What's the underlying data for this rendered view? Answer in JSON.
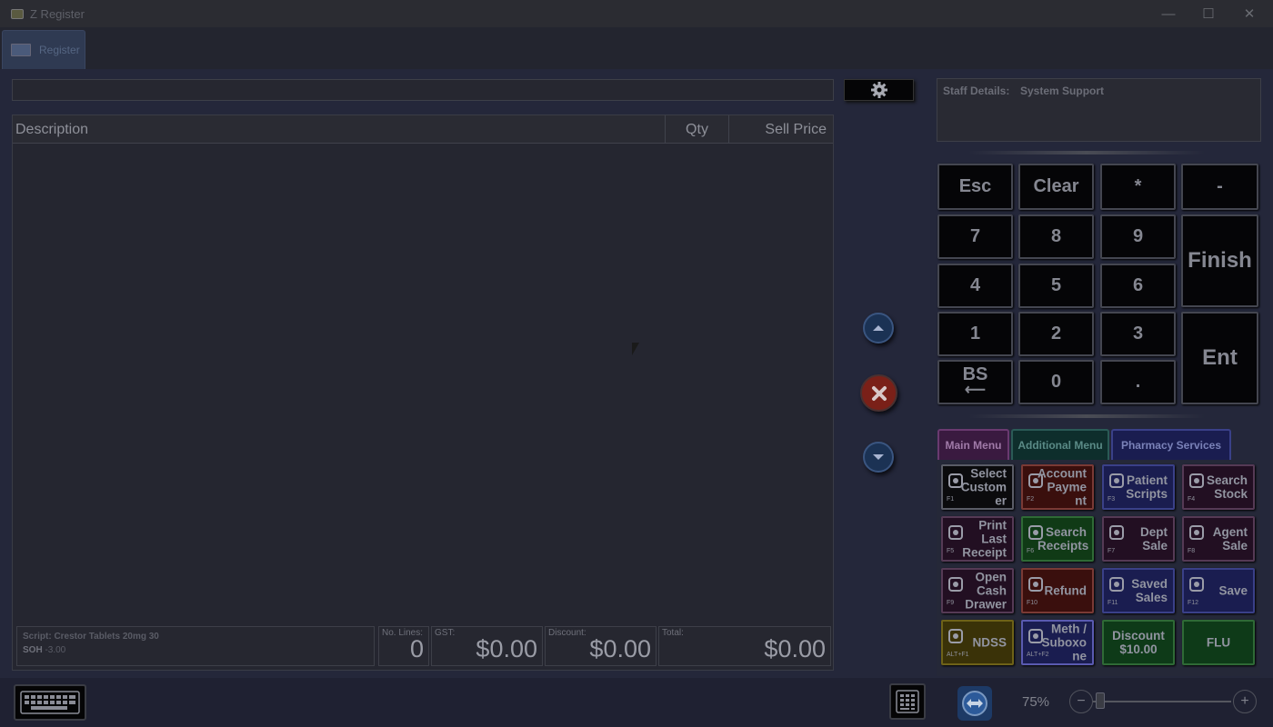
{
  "window": {
    "title": "Z Register",
    "minimize": "—",
    "maximize": "☐",
    "close": "✕"
  },
  "tabs": [
    {
      "label": "Register"
    }
  ],
  "grid": {
    "col_description": "Description",
    "col_qty": "Qty",
    "col_sell_price": "Sell Price",
    "rows": []
  },
  "footer": {
    "script": "Script: Crestor Tablets 20mg 30",
    "soh_label": "SOH",
    "soh_value": "-3.00",
    "no_lines_label": "No. Lines:",
    "no_lines_value": "0",
    "gst_label": "GST:",
    "gst_value": "$0.00",
    "discount_label": "Discount:",
    "discount_value": "$0.00",
    "total_label": "Total:",
    "total_value": "$0.00"
  },
  "staff": {
    "label": "Staff Details:",
    "value": "System Support"
  },
  "keypad": {
    "esc": "Esc",
    "clear": "Clear",
    "star": "*",
    "minus": "-",
    "k7": "7",
    "k8": "8",
    "k9": "9",
    "finish": "Finish",
    "k4": "4",
    "k5": "5",
    "k6": "6",
    "k1": "1",
    "k2": "2",
    "k3": "3",
    "ent": "Ent",
    "bs": "BS",
    "bs_arrow": "⟵",
    "k0": "0",
    "dot": "."
  },
  "menu_tabs": {
    "main": "Main Menu",
    "additional": "Additional Menu",
    "pharmacy": "Pharmacy Services"
  },
  "function_buttons": [
    {
      "label": "Select\nCustom\ner",
      "key": "F1",
      "icon": "person-icon",
      "bg": "#0b0b0d",
      "border": "#5a5c66"
    },
    {
      "label": "Account\nPayme\nnt",
      "key": "F2",
      "icon": "coins-icon",
      "bg": "#3a0f0d",
      "border": "#7a3a35"
    },
    {
      "label": "Patient\nScripts",
      "key": "F3",
      "icon": "mortar-icon",
      "bg": "#1a1d50",
      "border": "#3a4088"
    },
    {
      "label": "Search\nStock",
      "key": "F4",
      "icon": "box-icon",
      "bg": "#220f22",
      "border": "#553a55"
    },
    {
      "label": "Print\nLast\nReceipt",
      "key": "F5",
      "icon": "printer-icon",
      "bg": "#220f22",
      "border": "#553a55"
    },
    {
      "label": "Search\nReceipts",
      "key": "F6",
      "icon": "receipt-icon",
      "bg": "#103a16",
      "border": "#2f6a36"
    },
    {
      "label": "Dept\nSale",
      "key": "F7",
      "icon": "hierarchy-icon",
      "bg": "#220f22",
      "border": "#553a55"
    },
    {
      "label": "Agent\nSale",
      "key": "F8",
      "icon": "handshake-icon",
      "bg": "#220f22",
      "border": "#553a55"
    },
    {
      "label": "Open\nCash\nDrawer",
      "key": "F9",
      "icon": "cash-register-icon",
      "bg": "#220f22",
      "border": "#553a55"
    },
    {
      "label": "Refund",
      "key": "F10",
      "icon": "cart-icon",
      "bg": "#3a0f0d",
      "border": "#7a3a35"
    },
    {
      "label": "Saved\nSales",
      "key": "F11",
      "icon": "clipboard-icon",
      "bg": "#1a1d50",
      "border": "#3a4088"
    },
    {
      "label": "Save",
      "key": "F12",
      "icon": "floppy-icon",
      "bg": "#1a1d50",
      "border": "#3a4088"
    },
    {
      "label": "NDSS",
      "key": "ALT+F1",
      "icon": "return-arrow-icon",
      "bg": "#3a3208",
      "border": "#6e6218"
    },
    {
      "label": "Meth /\nSuboxo\nne",
      "key": "ALT+F2",
      "icon": "bottle-icon",
      "bg": "#1a1d50",
      "border": "#5a5ab0"
    },
    {
      "label": "Discount\n$10.00",
      "key": "",
      "icon": "",
      "bg": "#0e3a18",
      "border": "#2f6a36"
    },
    {
      "label": "FLU",
      "key": "",
      "icon": "",
      "bg": "#0e3a18",
      "border": "#2f6a36"
    }
  ],
  "status": {
    "zoom": "75%",
    "zoom_minus": "−",
    "zoom_plus": "+"
  }
}
